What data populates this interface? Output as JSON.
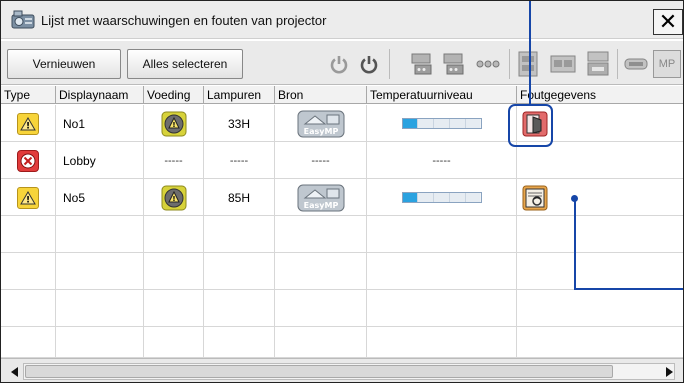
{
  "window": {
    "title": "Lijst met waarschuwingen en fouten van projector",
    "close_glyph": "✕"
  },
  "toolbar": {
    "refresh_label": "Vernieuwen",
    "select_all_label": "Alles selecteren",
    "icons": [
      "power-on-icon",
      "power-off-icon",
      "input-computer1-icon",
      "input-computer2-icon",
      "input-more-icon",
      "input-video-icon",
      "input-svideo-icon",
      "input-hdmi-icon",
      "input-usb-icon",
      "input-mp-icon"
    ],
    "mp_label": "MP"
  },
  "table": {
    "columns": [
      "Type",
      "Displaynaam",
      "Voeding",
      "Lampuren",
      "Bron",
      "Temperatuurniveau",
      "Foutgegevens"
    ],
    "rows": [
      {
        "type": "warning",
        "name": "No1",
        "power": "warning-lamp",
        "lamp_hours": "33H",
        "source": "EasyMP",
        "temperature_fill": 0.2,
        "error": "cover-open"
      },
      {
        "type": "error",
        "name": "Lobby",
        "power": "-----",
        "lamp_hours": "-----",
        "source": "-----",
        "temperature": "-----",
        "error": ""
      },
      {
        "type": "warning",
        "name": "No5",
        "power": "warning-lamp",
        "lamp_hours": "85H",
        "source": "EasyMP",
        "temperature_fill": 0.2,
        "error": "filter-error"
      }
    ],
    "easymp_label": "EasyMP"
  },
  "colors": {
    "accent_callout": "#1646a8",
    "warning_yellow": "#f7d43a",
    "error_red": "#e23b3b",
    "temp_fill": "#2aa2e0"
  }
}
